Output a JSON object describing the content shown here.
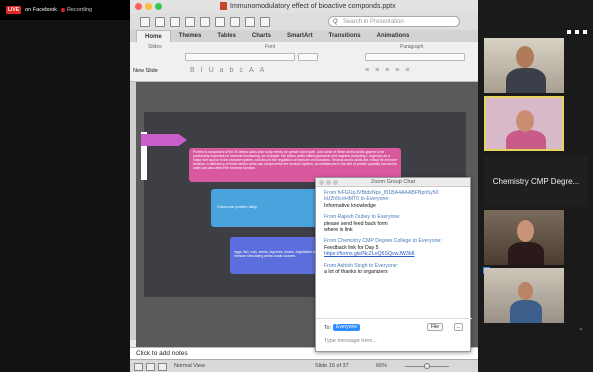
{
  "banner": {
    "live": "LIVE",
    "facebook": "on Facebook",
    "recording": "Recording"
  },
  "window": {
    "title": "Immunomodulatory effect of bioactive componds.pptx"
  },
  "search": {
    "placeholder": "Search in Presentation"
  },
  "ribbon_tabs": [
    "Home",
    "Themes",
    "Tables",
    "Charts",
    "SmartArt",
    "Transitions",
    "Animations"
  ],
  "ribbon_groups": {
    "slides": "Slides",
    "font": "Font",
    "paragraph": "Paragraph"
  },
  "new_slide": "New Slide",
  "slide": {
    "pink_text": "Protein is composed of the 20 amino acids your body needs for growth and repair. Just some of these amino acids appear to be particularly important for immune functioning, for example: the amino acids called glutamine and arginine (including L-arginine) as a major fuel source in the immune system, and also in the regulation of immune cell functions. Several amino acids are critical for immune function. A deficiency of these amino acids can compromise the immune system, as imbalances in the diet of protein quantity and amino acids can also affect the immune function.",
    "blue1_text": "Consume protein daily.",
    "blue2_text": "eggs, fish, nuts, seeds, legumes, beans, vegetables and many of the immune stimulating amino acids sources."
  },
  "notes": {
    "placeholder": "Click to add notes"
  },
  "status": {
    "view": "Normal View",
    "slide_pos": "Slide 15 of 37",
    "zoom": "66%"
  },
  "chat": {
    "title": "Zoom Group Chat",
    "messages": [
      {
        "from": "From fvFGUpJVBtdsNps_f01BA4AAABFBpn5y50 kU2h0crrHMT0 to Everyone:",
        "body": "Informative knowledge",
        "link": ""
      },
      {
        "from": "From Rajesh Dubey to Everyone:",
        "body": "please send feed back form\nwhere is link",
        "link": ""
      },
      {
        "from": "From Chemistry CMP Degree College to Everyone:",
        "body": "Feedback link for Day 5",
        "link": "https://forms.gle/NcZLeQ6SQvwJW3b8"
      },
      {
        "from": "From Ashish Singh to Everyone:",
        "body": "a lot of thanks to organizers",
        "link": ""
      }
    ],
    "to_label": "To:",
    "to_value": "Everyone",
    "file_button": "File",
    "more_button": "...",
    "input_placeholder": "Type message here..."
  },
  "gallery": {
    "name_tile": "Chemistry CMP Degre..."
  },
  "colors": {
    "accent": "#2d8cff",
    "live_red": "#e02424",
    "pink_box": "#d9599e",
    "blue_box": "#4aa3dd",
    "purple_box": "#5b6edc"
  }
}
